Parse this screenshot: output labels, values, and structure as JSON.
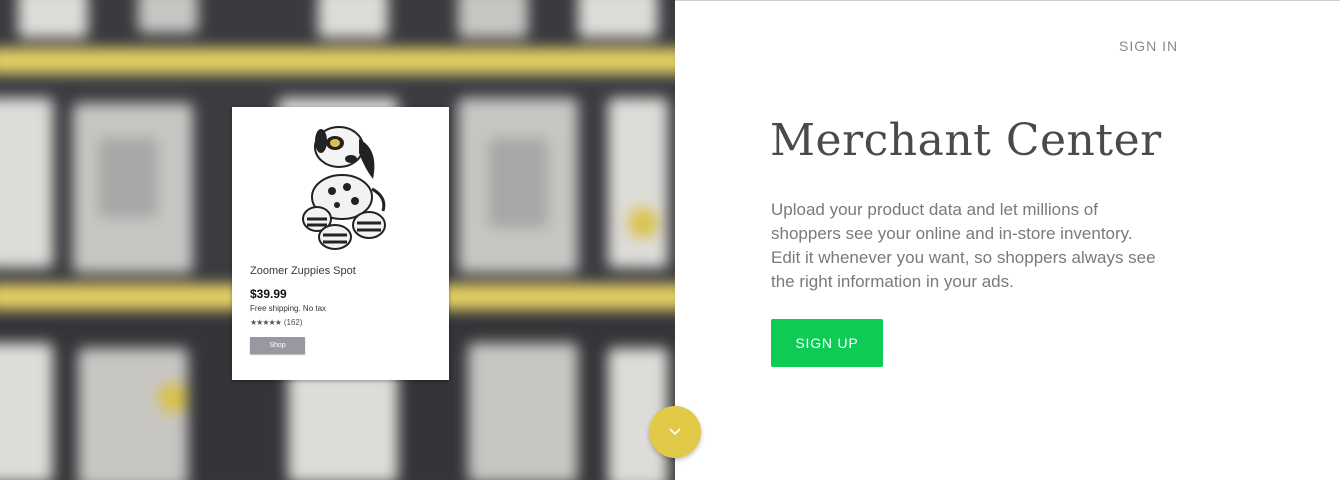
{
  "header": {
    "sign_in_label": "SIGN IN"
  },
  "hero": {
    "product_card": {
      "title": "Zoomer Zuppies Spot",
      "price": "$39.99",
      "shipping": "Free shipping. No tax",
      "stars": "★★★★★",
      "rating_count": "(162)",
      "shop_label": "Shop"
    },
    "scroll_icon": "chevron-down-icon"
  },
  "main": {
    "title": "Merchant Center",
    "description": "Upload your product data and let millions of shoppers see your online and in-store inventory. Edit it whenever you want, so shoppers always see the right information in your ads.",
    "signup_label": "SIGN UP"
  },
  "colors": {
    "signup_button": "#0ecb56",
    "scroll_button": "#e2c948",
    "shelf_yellow": "#e4d064"
  }
}
